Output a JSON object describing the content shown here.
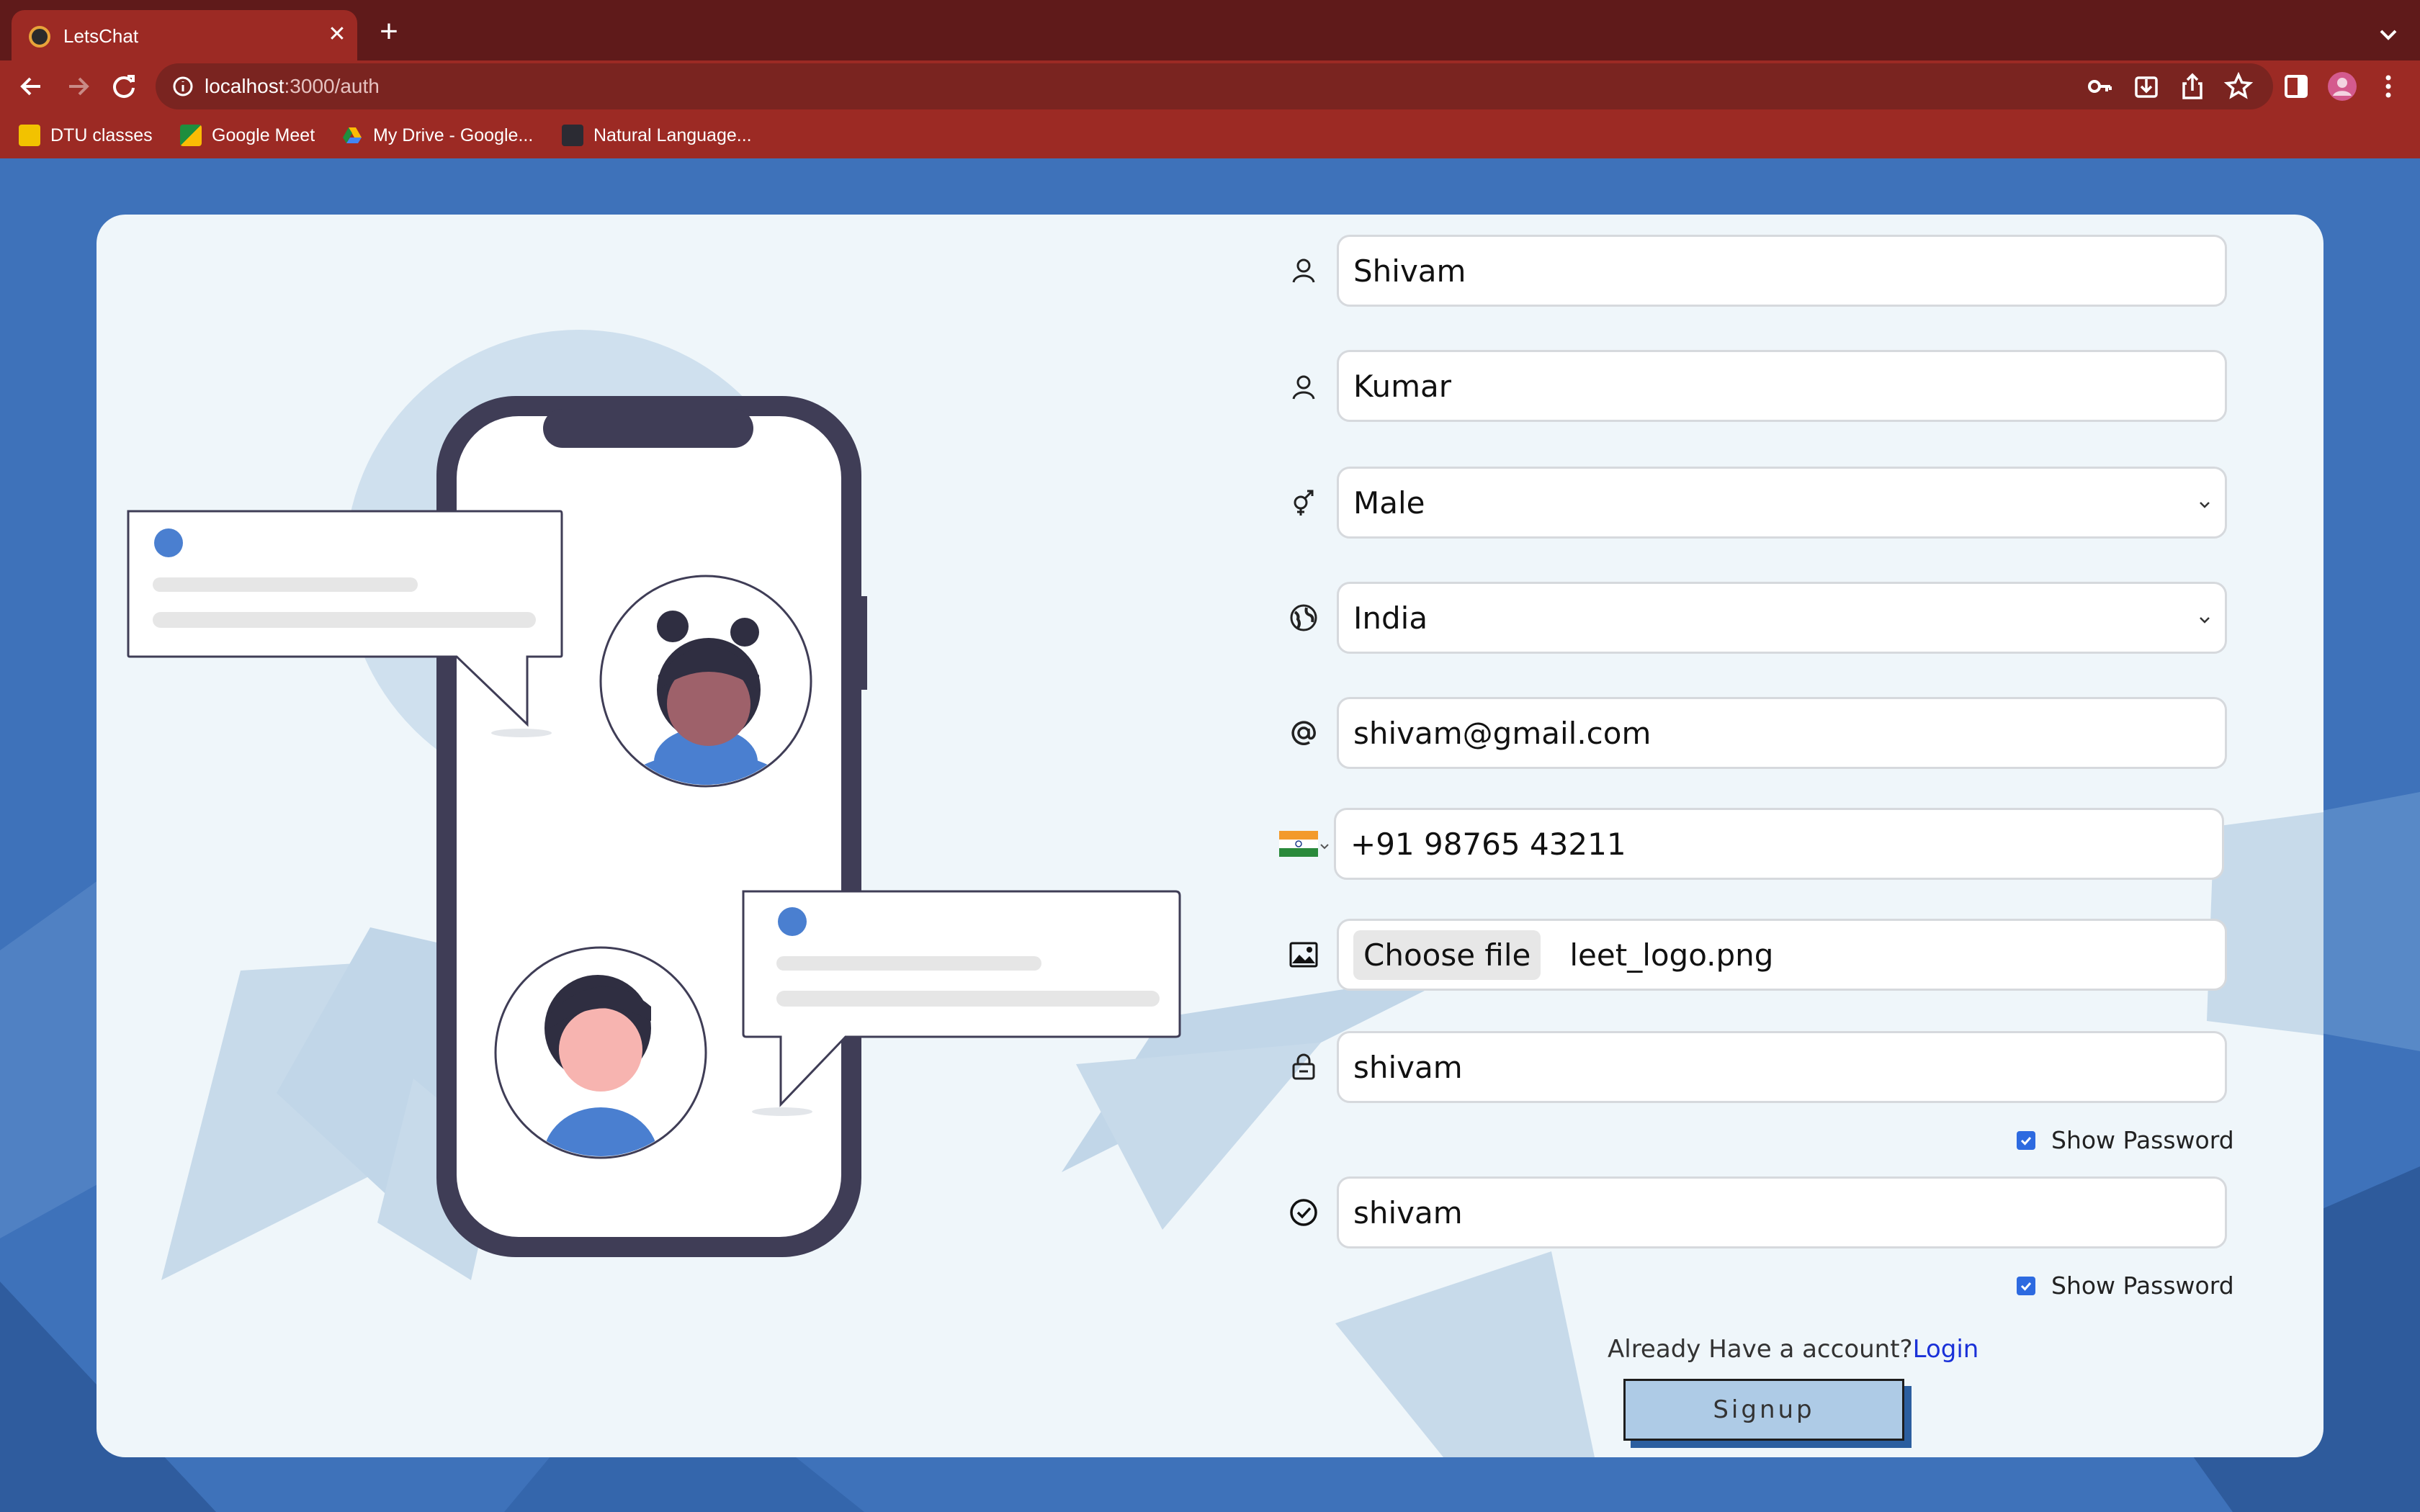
{
  "browser": {
    "tab_title": "LetsChat",
    "url_host": "localhost",
    "url_path": ":3000/auth",
    "bookmarks": [
      "DTU classes",
      "Google Meet",
      "My Drive - Google...",
      "Natural Language..."
    ]
  },
  "form": {
    "first_name": "Shivam",
    "last_name": "Kumar",
    "gender": "Male",
    "country": "India",
    "email": "shivam@gmail.com",
    "phone": "+91 98765 43211",
    "file_button": "Choose file",
    "file_name": "leet_logo.png",
    "password": "shivam",
    "confirm_password": "shivam",
    "show_password_label": "Show Password",
    "show_password_checked": true,
    "already_text": "Already Have a account?",
    "login_link": "Login",
    "signup_button": "Signup"
  },
  "colors": {
    "accent": "#3e72ba",
    "browser_frame": "#9c2a24",
    "card_background": "#eff6fa",
    "signup_button": "#aecbe6"
  }
}
